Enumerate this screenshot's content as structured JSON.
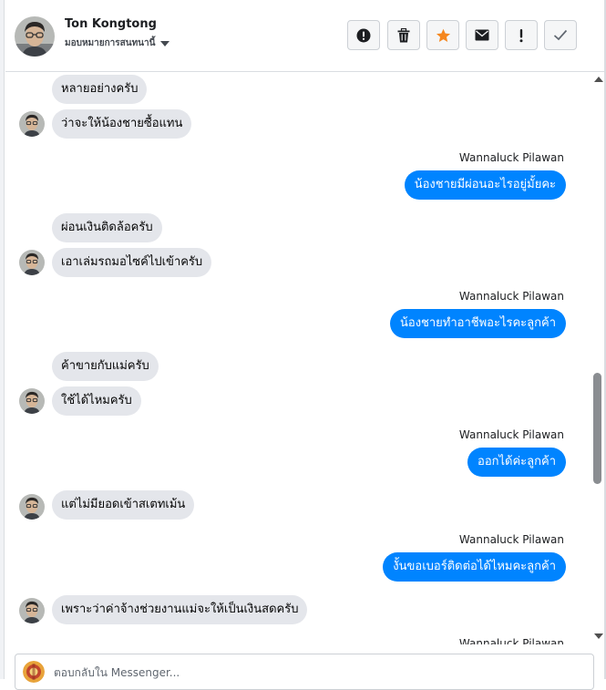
{
  "header": {
    "contact_name": "Ton Kongtong",
    "assign_label": "มอบหมายการสนทนานี้"
  },
  "toolbar": [
    {
      "name": "report-spam-button",
      "icon": "exclamation-circle-icon"
    },
    {
      "name": "delete-button",
      "icon": "trash-icon"
    },
    {
      "name": "star-button",
      "icon": "star-icon",
      "color": "#f5871f"
    },
    {
      "name": "mark-unread-button",
      "icon": "envelope-icon"
    },
    {
      "name": "follow-up-button",
      "icon": "exclamation-icon"
    },
    {
      "name": "mark-done-button",
      "icon": "checkmark-icon"
    }
  ],
  "conversation": {
    "incoming_bubble_color": "#e4e6eb",
    "outgoing_bubble_color": "#0084ff",
    "messages": [
      {
        "dir": "in",
        "text": "หลายอย่างครับ"
      },
      {
        "dir": "in",
        "text": "ว่าจะให้น้องชายซื้อแทน"
      },
      {
        "dir": "out",
        "sender": "Wannaluck Pilawan",
        "text": "น้องชายมีผ่อนอะไรอยู่มั้ยคะ"
      },
      {
        "dir": "in",
        "text": "ผ่อนเงินติดล้อครับ"
      },
      {
        "dir": "in",
        "text": "เอาเล่มรถมอไซค์ไปเข้าครับ"
      },
      {
        "dir": "out",
        "sender": "Wannaluck Pilawan",
        "text": "น้องชายทำอาชีพอะไรคะลูกค้า"
      },
      {
        "dir": "in",
        "text": "ค้าขายกับแม่ครับ"
      },
      {
        "dir": "in",
        "text": "ใช้ได้ไหมครับ"
      },
      {
        "dir": "out",
        "sender": "Wannaluck Pilawan",
        "text": "ออกได้ค่ะลูกค้า"
      },
      {
        "dir": "in",
        "text": "แต่ไม่มียอดเข้าสเตทเม้น"
      },
      {
        "dir": "out",
        "sender": "Wannaluck Pilawan",
        "text": "งั้นขอเบอร์ติดต่อได้ไหมคะลูกค้า"
      },
      {
        "dir": "in",
        "text": "เพราะว่าค่าจ้างช่วยงานแม่จะให้เป็นเงินสดครับ"
      },
      {
        "dir": "out",
        "sender": "Wannaluck Pilawan",
        "text": ""
      }
    ]
  },
  "composer": {
    "placeholder": "ตอบกลับใน Messenger..."
  }
}
